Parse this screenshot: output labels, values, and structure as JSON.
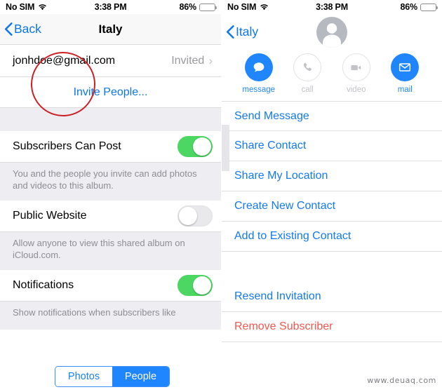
{
  "left_phone": {
    "status_bar": {
      "carrier": "No SIM",
      "wifi_icon": "wifi-icon",
      "time": "3:38 PM",
      "battery_percent": "86%",
      "battery_level": 86
    },
    "nav": {
      "back_label": "Back",
      "back_icon": "chevron-left-icon",
      "title": "Italy"
    },
    "subscriber_row": {
      "email": "jonhdoe@gmail.com",
      "status": "Invited",
      "disclosure_icon": "chevron-right-icon"
    },
    "invite_row": {
      "label": "Invite People..."
    },
    "settings": [
      {
        "label": "Subscribers Can Post",
        "toggle_state": "on",
        "footnote": "You and the people you invite can add photos and videos to this album."
      },
      {
        "label": "Public Website",
        "toggle_state": "off",
        "footnote": "Allow anyone to view this shared album on iCloud.com."
      },
      {
        "label": "Notifications",
        "toggle_state": "on",
        "footnote": "Show notifications when subscribers like"
      }
    ],
    "segmented_control": {
      "options": [
        {
          "label": "Photos",
          "selected": false
        },
        {
          "label": "People",
          "selected": true
        }
      ]
    },
    "annotation": {
      "shape": "ellipse",
      "color": "#cc2026",
      "targets": "subscriber_row.email"
    }
  },
  "right_phone": {
    "status_bar": {
      "carrier": "No SIM",
      "wifi_icon": "wifi-icon",
      "time": "3:38 PM",
      "battery_percent": "86%",
      "battery_level": 86
    },
    "nav": {
      "back_label": "Italy",
      "back_icon": "chevron-left-icon",
      "avatar_icon": "person-avatar-icon"
    },
    "quick_actions": [
      {
        "label": "message",
        "icon": "message-bubble-icon",
        "enabled": true
      },
      {
        "label": "call",
        "icon": "phone-icon",
        "enabled": false
      },
      {
        "label": "video",
        "icon": "video-camera-icon",
        "enabled": false
      },
      {
        "label": "mail",
        "icon": "envelope-icon",
        "enabled": true
      }
    ],
    "menu_group_1": [
      {
        "label": "Send Message",
        "style": "link"
      },
      {
        "label": "Share Contact",
        "style": "link"
      },
      {
        "label": "Share My Location",
        "style": "link"
      },
      {
        "label": "Create New Contact",
        "style": "link"
      },
      {
        "label": "Add to Existing Contact",
        "style": "link"
      }
    ],
    "menu_group_2": [
      {
        "label": "Resend Invitation",
        "style": "link"
      },
      {
        "label": "Remove Subscriber",
        "style": "danger"
      }
    ]
  },
  "watermark": {
    "text": "www.deuaq.com"
  },
  "colors": {
    "accent_blue": "#1f86ff",
    "link_blue": "#1479f0",
    "danger_red": "#f4564f",
    "toggle_green": "#4cd763",
    "annotation_red": "#cc2026",
    "group_bg": "#ededf2"
  }
}
